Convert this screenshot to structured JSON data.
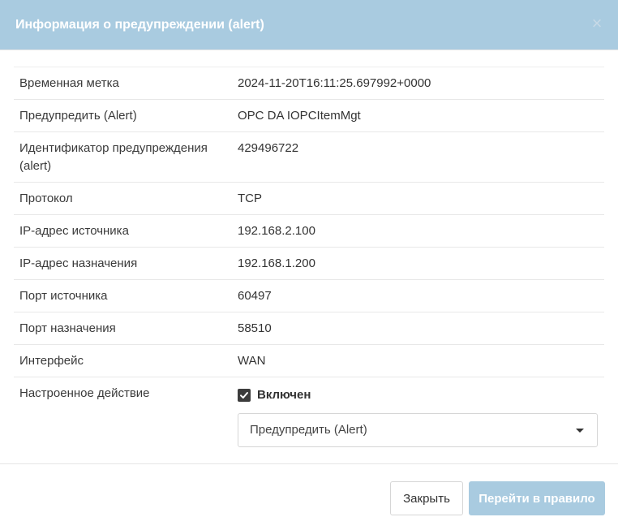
{
  "header": {
    "title": "Информация о предупреждении (alert)",
    "close_symbol": "×"
  },
  "rows": [
    {
      "label": "Временная метка",
      "value": "2024-11-20T16:11:25.697992+0000"
    },
    {
      "label": "Предупредить (Alert)",
      "value": "OPC DA IOPCItemMgt"
    },
    {
      "label": "Идентификатор предупреждения (alert)",
      "value": "429496722"
    },
    {
      "label": "Протокол",
      "value": "TCP"
    },
    {
      "label": "IP-адрес источника",
      "value": "192.168.2.100"
    },
    {
      "label": "IP-адрес назначения",
      "value": "192.168.1.200"
    },
    {
      "label": "Порт источника",
      "value": "60497"
    },
    {
      "label": "Порт назначения",
      "value": "58510"
    },
    {
      "label": "Интерфейс",
      "value": "WAN"
    }
  ],
  "action": {
    "label": "Настроенное действие",
    "enabled_label": "Включен",
    "enabled_checked": true,
    "select_value": "Предупредить (Alert)"
  },
  "footer": {
    "close_label": "Закрыть",
    "goto_rule_label": "Перейти в правило"
  },
  "colors": {
    "header_bg": "#a9cbe0",
    "primary_button_bg": "#a9cbe0"
  }
}
